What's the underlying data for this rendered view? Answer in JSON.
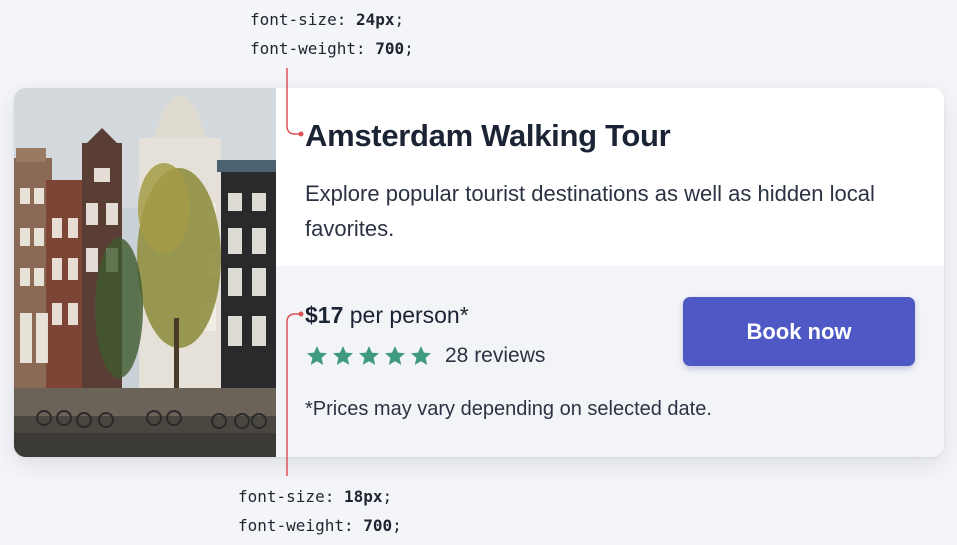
{
  "annotations": {
    "top": {
      "line1_prop": "font-size: ",
      "line1_val": "24px",
      "line2_prop": "font-weight: ",
      "line2_val": "700"
    },
    "bottom": {
      "line1_prop": "font-size: ",
      "line1_val": "18px",
      "line2_prop": "font-weight: ",
      "line2_val": "700"
    }
  },
  "card": {
    "image_subject": "amsterdam-canal-houses-photo",
    "title": "Amsterdam Walking Tour",
    "description": "Explore popular tourist destinations as well as hidden local favorites.",
    "price": {
      "amount": "$17",
      "suffix": " per person*"
    },
    "rating": {
      "stars": 5,
      "max_stars": 5,
      "reviews_text": "28 reviews"
    },
    "note": "*Prices may vary depending on selected date.",
    "book_button_label": "Book now"
  },
  "colors": {
    "accent": "#4f59c6",
    "star": "#3f9a80",
    "pointer": "#e0525a",
    "text": "#1b2434"
  }
}
